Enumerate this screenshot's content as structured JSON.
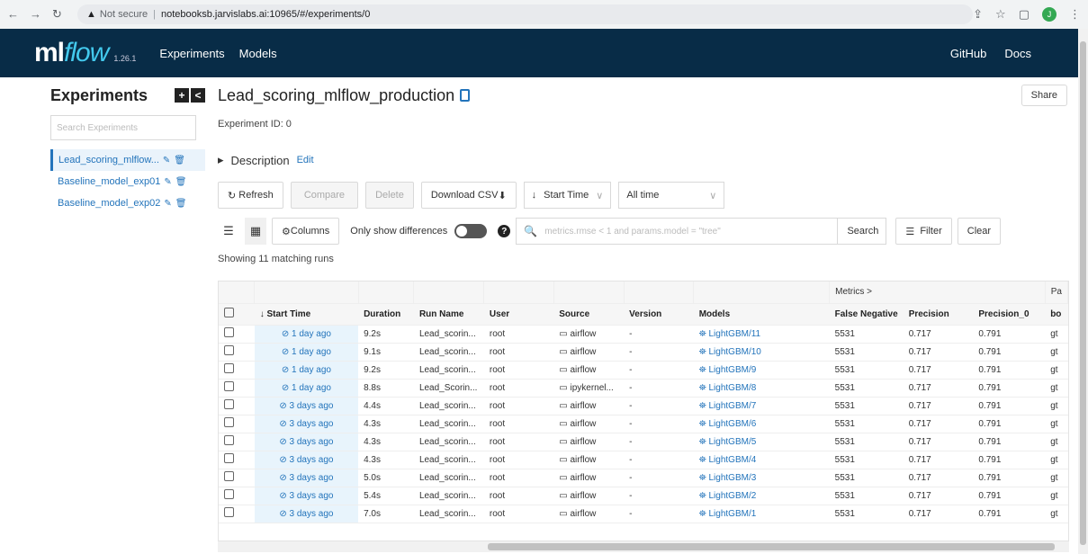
{
  "browser": {
    "security_text": "Not secure",
    "url_host": "notebooksb.jarvislabs.ai",
    "url_rest": ":10965/#/experiments/0",
    "avatar_initial": "J"
  },
  "header": {
    "logo_ml": "ml",
    "logo_flow": "flow",
    "version": "1.26.1",
    "nav": [
      "Experiments",
      "Models"
    ],
    "right": [
      "GitHub",
      "Docs"
    ]
  },
  "sidebar": {
    "title": "Experiments",
    "search_placeholder": "Search Experiments",
    "items": [
      {
        "label": "Lead_scoring_mlflow..."
      },
      {
        "label": "Baseline_model_exp01"
      },
      {
        "label": "Baseline_model_exp02"
      }
    ]
  },
  "main": {
    "title": "Lead_scoring_mlflow_production",
    "share": "Share",
    "experiment_id": "Experiment ID:  0",
    "description": "Description",
    "edit": "Edit",
    "refresh": "Refresh",
    "compare": "Compare",
    "delete": "Delete",
    "download": "Download CSV",
    "sort": "Start Time",
    "time_range": "All time",
    "columns": "Columns",
    "only_diff": "Only show differences",
    "search_placeholder": "metrics.rmse < 1 and params.model = \"tree\"",
    "search_btn": "Search",
    "filter": "Filter",
    "clear": "Clear",
    "showing": "Showing 11 matching runs"
  },
  "table": {
    "metrics_group": "Metrics  >",
    "params_group": "Pa",
    "columns": [
      "Start Time",
      "Duration",
      "Run Name",
      "User",
      "Source",
      "Version",
      "Models",
      "False Negative",
      "Precision",
      "Precision_0",
      "bo"
    ],
    "rows": [
      [
        "1 day ago",
        "9.2s",
        "Lead_scorin...",
        "root",
        "airflow",
        "-",
        "LightGBM/11",
        "5531",
        "0.717",
        "0.791",
        "gt"
      ],
      [
        "1 day ago",
        "9.1s",
        "Lead_scorin...",
        "root",
        "airflow",
        "-",
        "LightGBM/10",
        "5531",
        "0.717",
        "0.791",
        "gt"
      ],
      [
        "1 day ago",
        "9.2s",
        "Lead_scorin...",
        "root",
        "airflow",
        "-",
        "LightGBM/9",
        "5531",
        "0.717",
        "0.791",
        "gt"
      ],
      [
        "1 day ago",
        "8.8s",
        "Lead_Scorin...",
        "root",
        "ipykernel...",
        "-",
        "LightGBM/8",
        "5531",
        "0.717",
        "0.791",
        "gt"
      ],
      [
        "3 days ago",
        "4.4s",
        "Lead_scorin...",
        "root",
        "airflow",
        "-",
        "LightGBM/7",
        "5531",
        "0.717",
        "0.791",
        "gt"
      ],
      [
        "3 days ago",
        "4.3s",
        "Lead_scorin...",
        "root",
        "airflow",
        "-",
        "LightGBM/6",
        "5531",
        "0.717",
        "0.791",
        "gt"
      ],
      [
        "3 days ago",
        "4.3s",
        "Lead_scorin...",
        "root",
        "airflow",
        "-",
        "LightGBM/5",
        "5531",
        "0.717",
        "0.791",
        "gt"
      ],
      [
        "3 days ago",
        "4.3s",
        "Lead_scorin...",
        "root",
        "airflow",
        "-",
        "LightGBM/4",
        "5531",
        "0.717",
        "0.791",
        "gt"
      ],
      [
        "3 days ago",
        "5.0s",
        "Lead_scorin...",
        "root",
        "airflow",
        "-",
        "LightGBM/3",
        "5531",
        "0.717",
        "0.791",
        "gt"
      ],
      [
        "3 days ago",
        "5.4s",
        "Lead_scorin...",
        "root",
        "airflow",
        "-",
        "LightGBM/2",
        "5531",
        "0.717",
        "0.791",
        "gt"
      ],
      [
        "3 days ago",
        "7.0s",
        "Lead_scorin...",
        "root",
        "airflow",
        "-",
        "LightGBM/1",
        "5531",
        "0.717",
        "0.791",
        "gt"
      ]
    ]
  }
}
